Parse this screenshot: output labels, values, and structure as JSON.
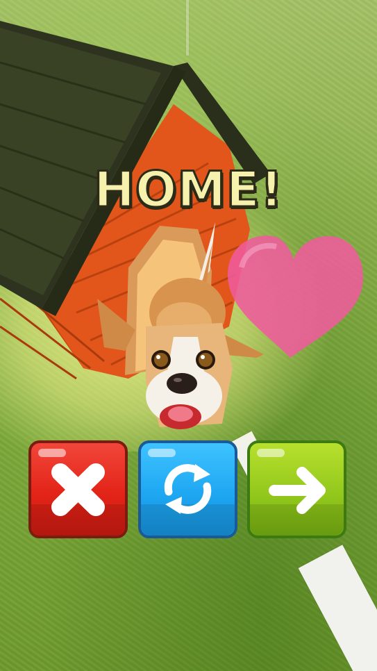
{
  "banner": {
    "text": "HOME!"
  },
  "buttons": {
    "close": {
      "icon": "close-icon",
      "color": "#e32418"
    },
    "retry": {
      "icon": "refresh-icon",
      "color": "#1ea7f2"
    },
    "next": {
      "icon": "arrow-right-icon",
      "color": "#93c81c"
    }
  },
  "scene": {
    "ground_color": "#7aa83a",
    "doghouse_wall_color": "#e2561b",
    "doghouse_roof_color": "#2e3320",
    "heart_color": "#ef5b9c"
  }
}
